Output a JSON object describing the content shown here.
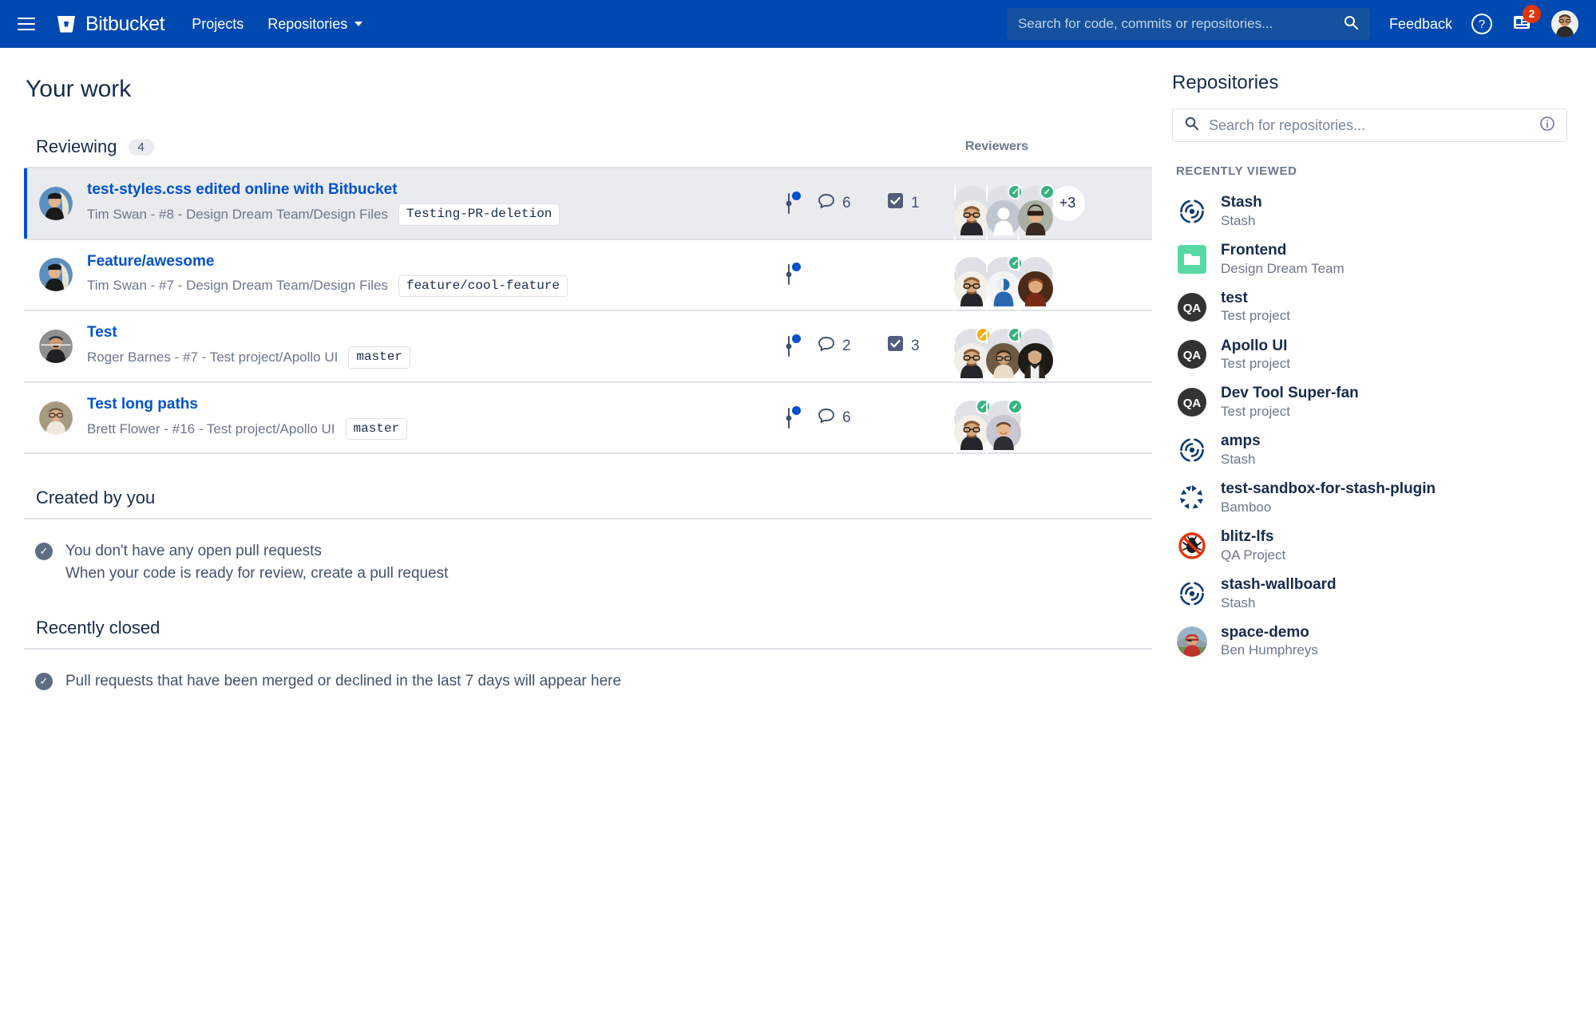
{
  "nav": {
    "menu_icon": "hamburger-icon",
    "brand": "Bitbucket",
    "projects": "Projects",
    "repositories": "Repositories",
    "search_placeholder": "Search for code, commits or repositories...",
    "search_value": "",
    "feedback": "Feedback",
    "help_icon": "question-circle-icon",
    "notifications_icon": "notifications-icon",
    "notification_count": "2",
    "avatar": "user-avatar",
    "bg_color": "#0049B0"
  },
  "page": {
    "title": "Your work"
  },
  "reviewing": {
    "title": "Reviewing",
    "count": "4",
    "reviewers_label": "Reviewers",
    "rows": [
      {
        "title": "test-styles.css edited online with Bitbucket",
        "subtitle": "Tim Swan - #8 - Design Dream Team/Design Files",
        "branch": "Testing-PR-deletion",
        "comments": "6",
        "tasks": "1",
        "selected": true,
        "overflow": "+3",
        "reviewers": [
          {
            "type": "photo-a",
            "badge": "none"
          },
          {
            "type": "placeholder",
            "badge": "approved"
          },
          {
            "type": "photo-b",
            "badge": "approved"
          }
        ]
      },
      {
        "title": "Feature/awesome",
        "subtitle": "Tim Swan - #7 - Design Dream Team/Design Files",
        "branch": "feature/cool-feature",
        "comments": "",
        "tasks": "",
        "selected": false,
        "overflow": "",
        "reviewers": [
          {
            "type": "photo-a",
            "badge": "none"
          },
          {
            "type": "default-blue",
            "badge": "approved"
          },
          {
            "type": "photo-c",
            "badge": "none"
          }
        ]
      },
      {
        "title": "Test",
        "subtitle": "Roger Barnes - #7 - Test project/Apollo UI",
        "branch": "master",
        "comments": "2",
        "tasks": "3",
        "selected": false,
        "overflow": "",
        "reviewers": [
          {
            "type": "photo-a",
            "badge": "needswork"
          },
          {
            "type": "photo-d",
            "badge": "approved"
          },
          {
            "type": "photo-e",
            "badge": "none"
          }
        ]
      },
      {
        "title": "Test long paths",
        "subtitle": "Brett Flower - #16 - Test project/Apollo UI",
        "branch": "master",
        "comments": "6",
        "tasks": "",
        "selected": false,
        "overflow": "",
        "reviewers": [
          {
            "type": "photo-a",
            "badge": "approved"
          },
          {
            "type": "photo-f",
            "badge": "approved"
          }
        ]
      }
    ]
  },
  "created_by_you": {
    "title": "Created by you",
    "empty_main": "You don't have any open pull requests",
    "empty_sub": "When your code is ready for review, create a pull request"
  },
  "recently_closed": {
    "title": "Recently closed",
    "empty_main": "Pull requests that have been merged or declined in the last 7 days will appear here"
  },
  "sidebar": {
    "title": "Repositories",
    "search_placeholder": "Search for repositories...",
    "search_value": "",
    "search_icon": "search-icon",
    "info_icon": "info-circle-icon",
    "recently_viewed_label": "RECENTLY VIEWED",
    "repos": [
      {
        "name": "Stash",
        "project": "Stash",
        "icon": "stash-logo-icon"
      },
      {
        "name": "Frontend",
        "project": "Design Dream Team",
        "icon": "green-folder-icon"
      },
      {
        "name": "test",
        "project": "Test project",
        "icon": "qa-circle-icon"
      },
      {
        "name": "Apollo UI",
        "project": "Test project",
        "icon": "qa-circle-icon"
      },
      {
        "name": "Dev Tool Super-fan",
        "project": "Test project",
        "icon": "qa-circle-icon"
      },
      {
        "name": "amps",
        "project": "Stash",
        "icon": "stash-logo-icon"
      },
      {
        "name": "test-sandbox-for-stash-plugin",
        "project": "Bamboo",
        "icon": "bamboo-logo-icon"
      },
      {
        "name": "blitz-lfs",
        "project": "QA Project",
        "icon": "no-bug-icon"
      },
      {
        "name": "stash-wallboard",
        "project": "Stash",
        "icon": "stash-logo-icon"
      },
      {
        "name": "space-demo",
        "project": "Ben Humphreys",
        "icon": "person-photo-icon"
      }
    ]
  },
  "colors": {
    "nav_blue": "#0049B0",
    "link_blue": "#0052CC",
    "approved_green": "#36B37E",
    "needswork_orange": "#FFAB00",
    "badge_red": "#DE350B",
    "text_dark": "#172B4D",
    "text_muted": "#6B778C"
  }
}
